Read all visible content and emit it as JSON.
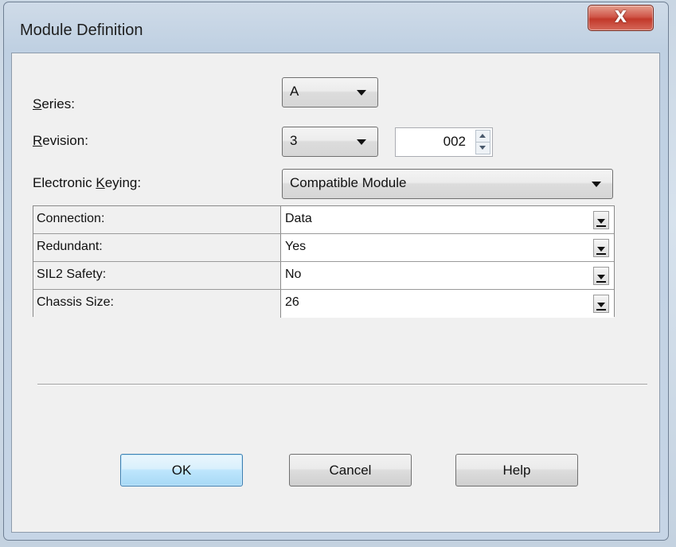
{
  "window": {
    "title": "Module Definition",
    "close_label": "X"
  },
  "series": {
    "label_prefix": "",
    "label_access": "S",
    "label_rest": "eries:",
    "value": "A"
  },
  "revision": {
    "label_access": "R",
    "label_rest": "evision:",
    "major": "3",
    "minor": "002"
  },
  "keying": {
    "label_prefix": "Electronic ",
    "label_access": "K",
    "label_rest": "eying:",
    "value": "Compatible Module"
  },
  "properties": [
    {
      "name": "Connection:",
      "value": "Data"
    },
    {
      "name": "Redundant:",
      "value": "Yes"
    },
    {
      "name": "SIL2 Safety:",
      "value": "No"
    },
    {
      "name": "Chassis Size:",
      "value": "26"
    }
  ],
  "buttons": {
    "ok": "OK",
    "cancel": "Cancel",
    "help": "Help"
  },
  "colors": {
    "default_button": "#bee6fd",
    "close_button": "#c2392a"
  }
}
